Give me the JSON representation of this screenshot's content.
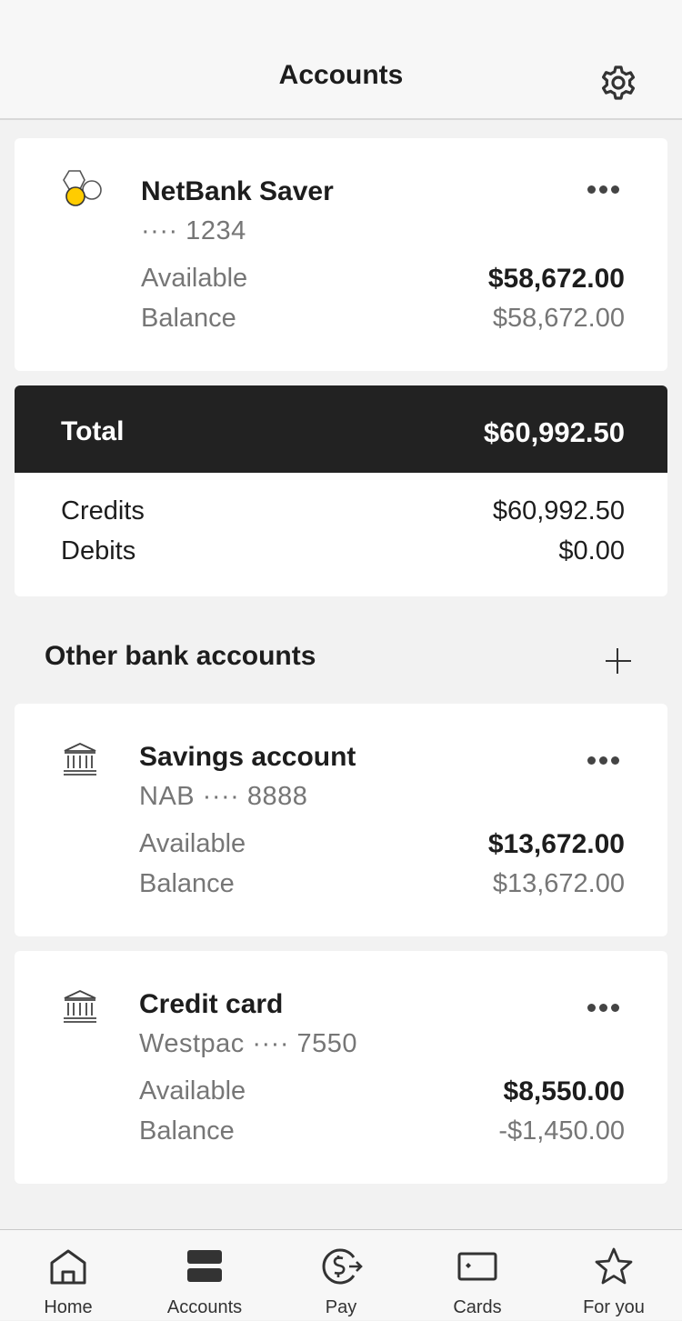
{
  "header": {
    "title": "Accounts",
    "settings_icon": "gear-icon"
  },
  "primary_account": {
    "name": "NetBank Saver",
    "number": "···· 1234",
    "available_label": "Available",
    "available_value": "$58,672.00",
    "balance_label": "Balance",
    "balance_value": "$58,672.00",
    "icon": "bubbles-logo-icon"
  },
  "totals": {
    "total_label": "Total",
    "total_value": "$60,992.50",
    "credits_label": "Credits",
    "credits_value": "$60,992.50",
    "debits_label": "Debits",
    "debits_value": "$0.00"
  },
  "other_accounts": {
    "title": "Other bank accounts",
    "add_icon": "plus-icon",
    "items": [
      {
        "name": "Savings account",
        "number": "NAB ···· 8888",
        "available_label": "Available",
        "available_value": "$13,672.00",
        "balance_label": "Balance",
        "balance_value": "$13,672.00",
        "icon": "bank-icon"
      },
      {
        "name": "Credit card",
        "number": "Westpac ···· 7550",
        "available_label": "Available",
        "available_value": "$8,550.00",
        "balance_label": "Balance",
        "balance_value": "-$1,450.00",
        "icon": "bank-icon"
      }
    ]
  },
  "tabbar": {
    "items": [
      {
        "label": "Home",
        "icon": "home-icon"
      },
      {
        "label": "Accounts",
        "icon": "accounts-icon"
      },
      {
        "label": "Pay",
        "icon": "pay-icon"
      },
      {
        "label": "Cards",
        "icon": "card-icon"
      },
      {
        "label": "For you",
        "icon": "star-icon"
      }
    ]
  }
}
